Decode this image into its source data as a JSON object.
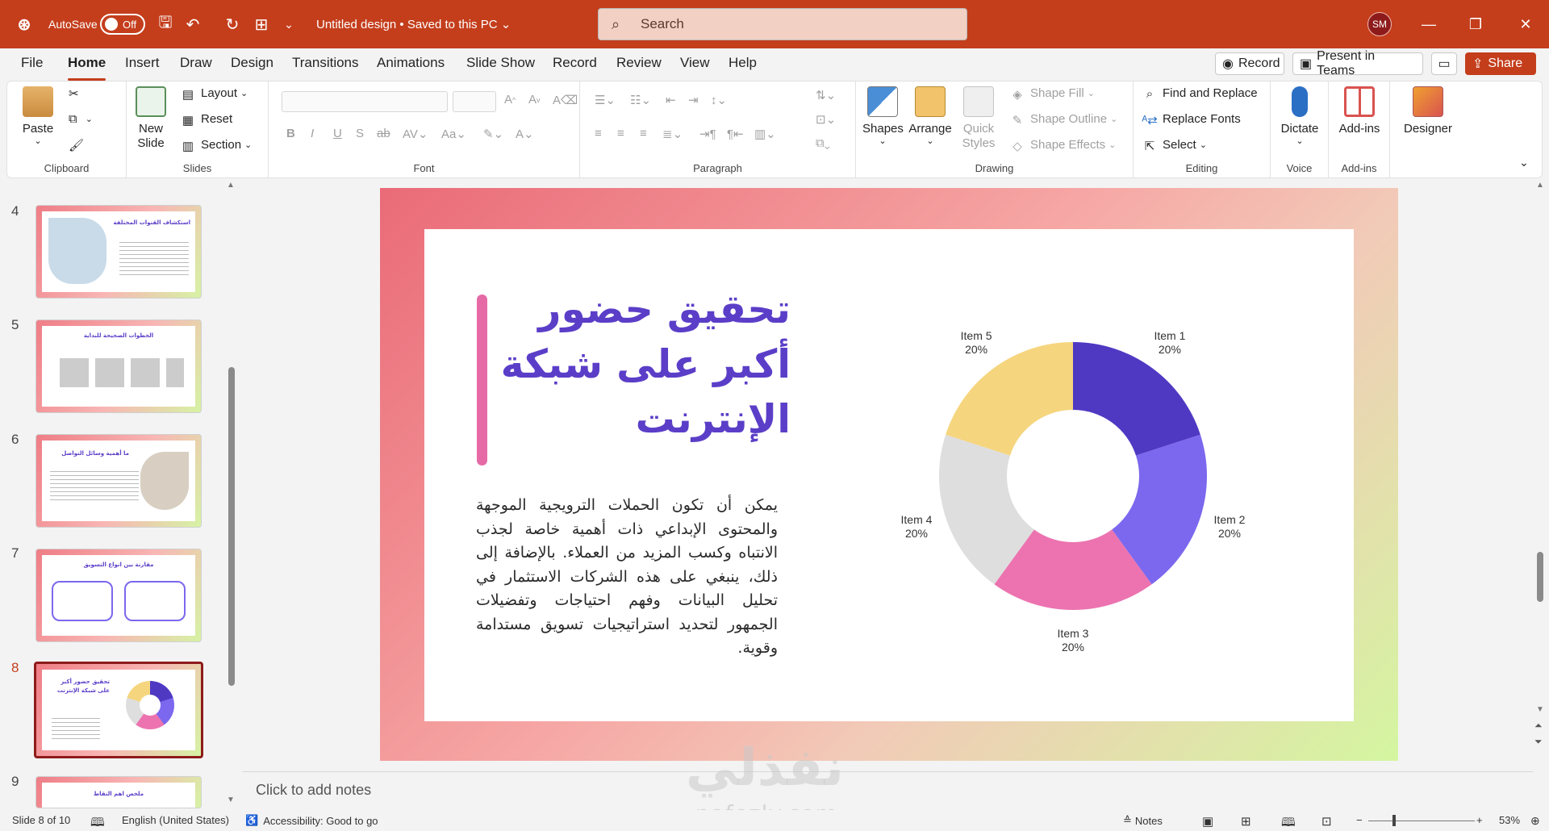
{
  "titlebar": {
    "autosave_label": "AutoSave",
    "autosave_state": "Off",
    "doc_title": "Untitled design • Saved to this PC ⌄",
    "search_placeholder": "Search",
    "avatar_initials": "SM",
    "brand_color": "#c43e1c"
  },
  "menu": {
    "tabs": [
      "File",
      "Home",
      "Insert",
      "Draw",
      "Design",
      "Transitions",
      "Animations",
      "Slide Show",
      "Record",
      "Review",
      "View",
      "Help"
    ],
    "active_tab": "Home",
    "record_label": "Record",
    "present_label": "Present in Teams",
    "share_label": "Share"
  },
  "ribbon": {
    "clipboard": {
      "paste": "Paste",
      "label": "Clipboard"
    },
    "slides": {
      "new_slide": "New Slide",
      "layout": "Layout",
      "reset": "Reset",
      "section": "Section",
      "label": "Slides"
    },
    "font": {
      "label": "Font"
    },
    "paragraph": {
      "label": "Paragraph"
    },
    "drawing": {
      "shapes": "Shapes",
      "arrange": "Arrange",
      "quick_styles": "Quick Styles",
      "shape_fill": "Shape Fill",
      "shape_outline": "Shape Outline",
      "shape_effects": "Shape Effects",
      "label": "Drawing"
    },
    "editing": {
      "find_replace": "Find and Replace",
      "replace_fonts": "Replace Fonts",
      "select": "Select",
      "label": "Editing"
    },
    "voice": {
      "dictate": "Dictate",
      "label": "Voice"
    },
    "addins": {
      "addins": "Add-ins",
      "label": "Add-ins"
    },
    "designer": {
      "designer": "Designer"
    }
  },
  "thumbnails": {
    "numbers": [
      "4",
      "5",
      "6",
      "7",
      "8",
      "9"
    ],
    "selected": "8",
    "titles": [
      "استكشاف القنوات المختلفة",
      "الخطوات الصحيحة للبداية",
      "ما أهمية وسائل التواصل",
      "مقارنة بين انواع التسويق",
      "تحقيق حضور أكبر على شبكة الإنترنت",
      "ملخص اهم النقاط"
    ]
  },
  "slide": {
    "title": "تحقيق حضور أكبر على شبكة الإنترنت",
    "body": "يمكن أن تكون الحملات الترويجية الموجهة والمحتوى الإبداعي ذات أهمية خاصة لجذب الانتباه وكسب المزيد من العملاء. بالإضافة إلى ذلك، ينبغي على هذه الشركات الاستثمار في تحليل البيانات وفهم احتياجات وتفضيلات الجمهور لتحديد استراتيجيات تسويق مستدامة وقوية."
  },
  "chart_data": {
    "type": "pie",
    "donut": true,
    "categories": [
      "Item 1",
      "Item 2",
      "Item 3",
      "Item 4",
      "Item 5"
    ],
    "values": [
      20,
      20,
      20,
      20,
      20
    ],
    "value_labels": [
      "20%",
      "20%",
      "20%",
      "20%",
      "20%"
    ],
    "colors": [
      "#4f39c3",
      "#7b68ee",
      "#ec73b0",
      "#dedede",
      "#f5d57e"
    ],
    "title": "",
    "legend": "none"
  },
  "notes": {
    "placeholder": "Click to add notes"
  },
  "status": {
    "slide_info": "Slide 8 of 10",
    "language": "English (United States)",
    "accessibility": "Accessibility: Good to go",
    "notes_btn": "Notes",
    "zoom": "53%"
  },
  "watermark": {
    "arabic": "نفذلي",
    "latin": "nafezly.com"
  }
}
